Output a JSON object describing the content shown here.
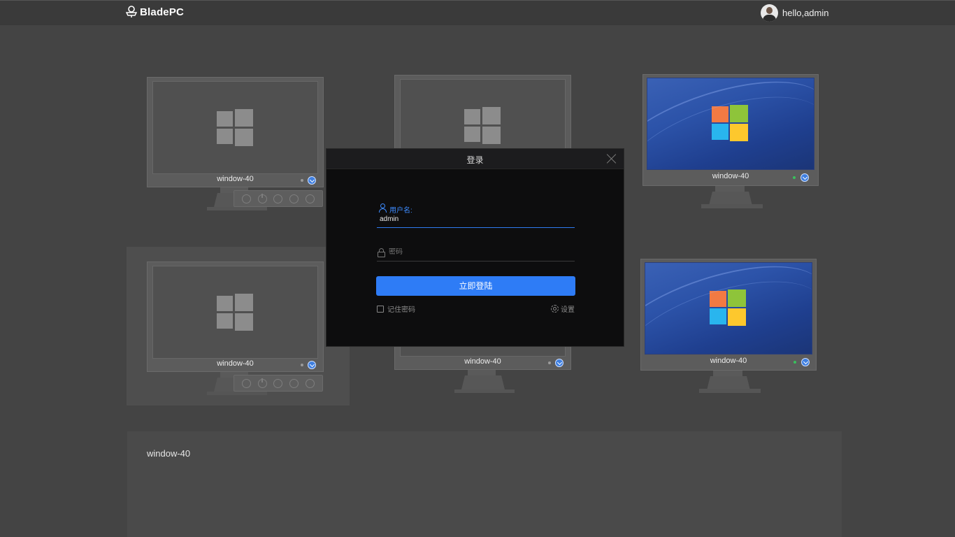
{
  "app": {
    "brand": "BladePC",
    "greeting": "hello,admin"
  },
  "monitors": [
    {
      "name": "window-40",
      "screen": "grey",
      "status": "grey",
      "toolbar": true,
      "selected": false
    },
    {
      "name": "window-40",
      "screen": "grey",
      "status": "grey",
      "toolbar": false,
      "selected": false
    },
    {
      "name": "window-40",
      "screen": "blue",
      "status": "green",
      "toolbar": false,
      "selected": false
    },
    {
      "name": "window-40",
      "screen": "grey",
      "status": "grey",
      "toolbar": true,
      "selected": true
    },
    {
      "name": "window-40",
      "screen": "grey",
      "status": "grey",
      "toolbar": false,
      "selected": false
    },
    {
      "name": "window-40",
      "screen": "blue",
      "status": "green",
      "toolbar": false,
      "selected": false
    }
  ],
  "detail": {
    "title": "window-40"
  },
  "login": {
    "title": "登录",
    "username_label": "用户名:",
    "username_value": "admin",
    "password_placeholder": "密码",
    "submit": "立即登陆",
    "remember": "记住密码",
    "settings": "设置"
  },
  "colors": {
    "accent": "#2e7cf6",
    "background": "#444444",
    "status_online": "#39c05d"
  },
  "icons": [
    "bladepc-logo-icon",
    "user-icon",
    "lock-icon",
    "gear-icon",
    "close-icon",
    "chevron-down-icon",
    "windows-logo-icon",
    "power-icon"
  ]
}
